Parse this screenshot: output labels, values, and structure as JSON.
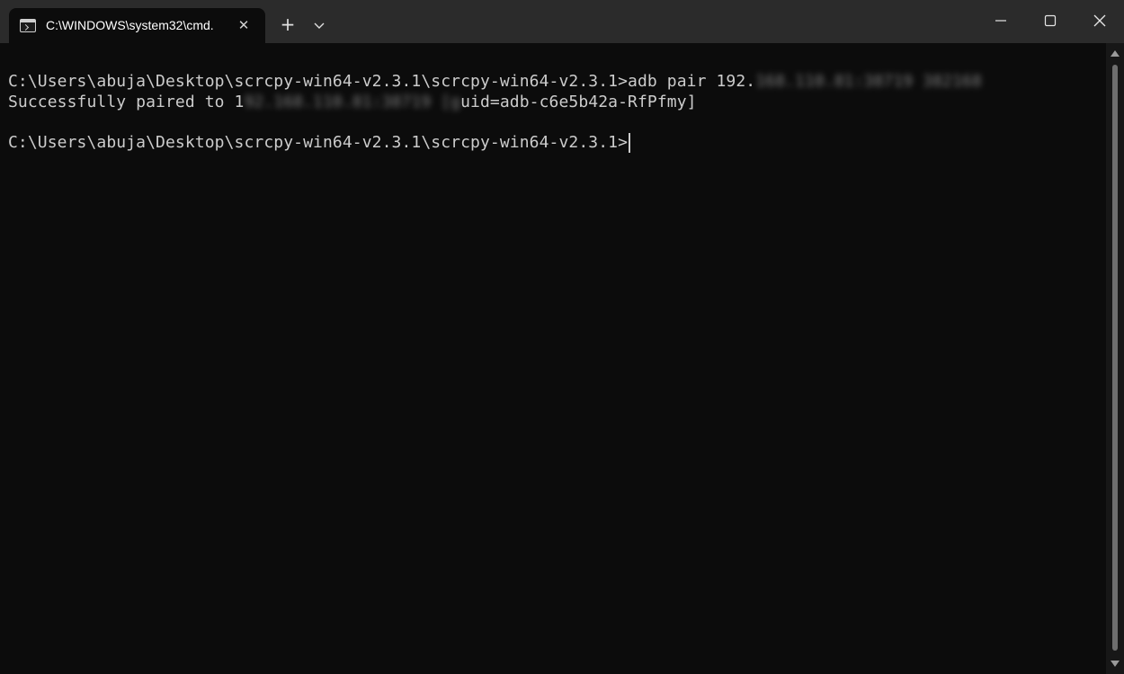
{
  "window": {
    "tab_title": "C:\\WINDOWS\\system32\\cmd.",
    "tab_icon": "cmd-icon",
    "new_tab_label": "+",
    "close_tab_label": "✕"
  },
  "terminal": {
    "line1_visible": "C:\\Users\\abuja\\Desktop\\scrcpy-win64-v2.3.1\\scrcpy-win64-v2.3.1>adb pair 192.",
    "line1_redacted": "168.110.81:38719 382168",
    "line2_prefix": "Successfully paired to 1",
    "line2_redacted": "92.168.110.81:38719 [g",
    "line2_suffix": "uid=adb-c6e5b42a-RfPfmy]",
    "line3_prompt": "C:\\Users\\abuja\\Desktop\\scrcpy-win64-v2.3.1\\scrcpy-win64-v2.3.1>"
  },
  "colors": {
    "background": "#0c0c0c",
    "titlebar": "#2b2b2b",
    "text": "#cccccc"
  }
}
